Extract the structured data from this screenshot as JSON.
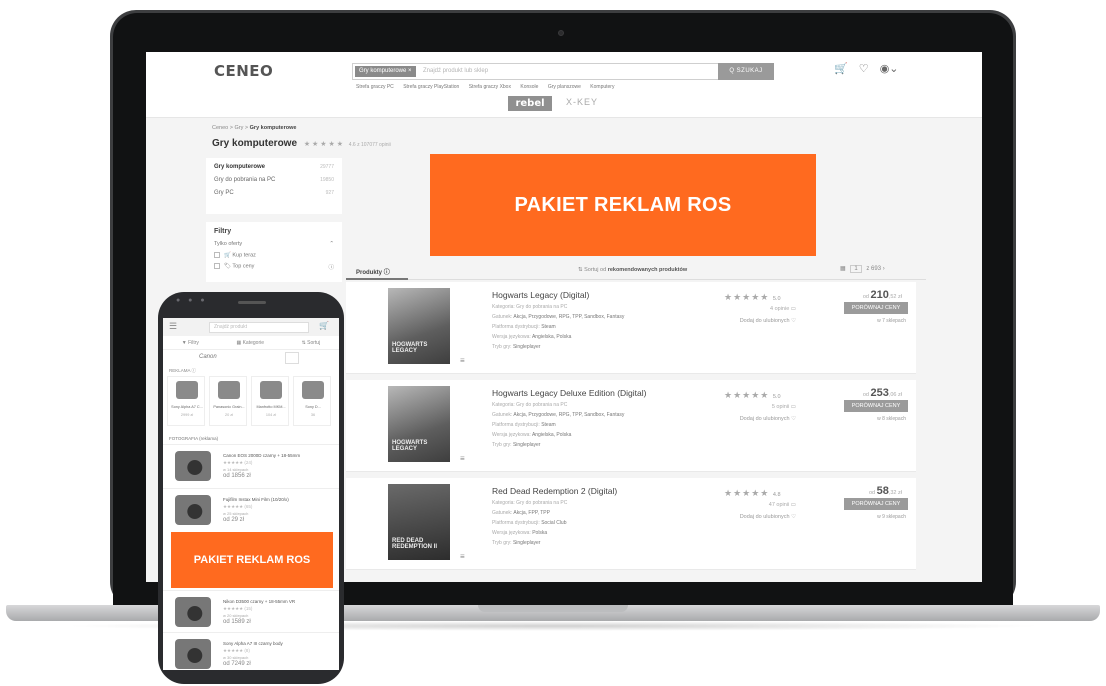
{
  "header": {
    "logo": "CENEO",
    "search_category": "Gry komputerowe ×",
    "search_placeholder": "Znajdź produkt lub sklep",
    "search_button": "Q SZUKAJ",
    "quick_links": [
      "Strefa graczy PC",
      "Strefa graczy PlayStation",
      "Strefa graczy Xbox",
      "Konsole",
      "Gry planszowe",
      "Komputery"
    ],
    "partner_rebel": "rebel",
    "partner_xkey": "X-KEY"
  },
  "breadcrumb": {
    "home": "Ceneo",
    "sep1": ">",
    "level1": "Gry",
    "sep2": ">",
    "current": "Gry komputerowe"
  },
  "page": {
    "title": "Gry komputerowe",
    "stars": "★ ★ ★ ★ ★",
    "rating_meta": "4.6 z 107077 opinii"
  },
  "categories": [
    {
      "label": "Gry komputerowe",
      "count": "29777"
    },
    {
      "label": "Gry do pobrania na PC",
      "count": "19850"
    },
    {
      "label": "Gry PC",
      "count": "927"
    }
  ],
  "filters": {
    "title": "Filtry",
    "only_offers": "Tylko oferty",
    "options": [
      "Kup teraz",
      "Top ceny"
    ]
  },
  "banner_laptop": "PAKIET REKLAM ROS",
  "list_header": {
    "tab_products": "Produkty",
    "sort_prefix": "Sortuj od",
    "sort_value": "rekomendowanych produktów",
    "page_current": "1",
    "page_total": "z 693"
  },
  "products": [
    {
      "name": "Hogwarts Legacy (Digital)",
      "category": "Kategoria: Gry do pobrania na PC",
      "genre_label": "Gatunek:",
      "genre": "Akcja, Przygodowe, RPG, TPP, Sandbox, Fantasy",
      "platform_label": "Platforma dystrybucji:",
      "platform": "Steam",
      "lang_label": "Wersja językowa:",
      "lang": "Angielska, Polska",
      "mode_label": "Tryb gry:",
      "mode": "Singleplayer",
      "stars": "★★★★★",
      "score": "5.0",
      "opinions": "4 opinie",
      "fav": "Dodaj do ulubionych",
      "price_prefix": "od",
      "price": "210",
      "price_cents": ",52 zł",
      "compare": "PORÓWNAJ CENY",
      "shops": "w 7 sklepach",
      "cover_text": "HOGWARTS LEGACY"
    },
    {
      "name": "Hogwarts Legacy Deluxe Edition (Digital)",
      "category": "Kategoria: Gry do pobrania na PC",
      "genre_label": "Gatunek:",
      "genre": "Akcja, Przygodowe, RPG, TPP, Sandbox, Fantasy",
      "platform_label": "Platforma dystrybucji:",
      "platform": "Steam",
      "lang_label": "Wersja językowa:",
      "lang": "Angielska, Polska",
      "mode_label": "Tryb gry:",
      "mode": "Singleplayer",
      "stars": "★★★★★",
      "score": "5.0",
      "opinions": "5 opinii",
      "fav": "Dodaj do ulubionych",
      "price_prefix": "od",
      "price": "253",
      "price_cents": ",06 zł",
      "compare": "PORÓWNAJ CENY",
      "shops": "w 8 sklepach",
      "cover_text": "HOGWARTS LEGACY"
    },
    {
      "name": "Red Dead Redemption 2 (Digital)",
      "category": "Kategoria: Gry do pobrania na PC",
      "genre_label": "Gatunek:",
      "genre": "Akcja, FPP, TPP",
      "platform_label": "Platforma dystrybucji:",
      "platform": "Social Club",
      "lang_label": "Wersja językowa:",
      "lang": "Polska",
      "mode_label": "Tryb gry:",
      "mode": "Singleplayer",
      "stars": "★★★★★",
      "score": "4.8",
      "opinions": "47 opinii",
      "fav": "Dodaj do ulubionych",
      "price_prefix": "od",
      "price": "58",
      "price_cents": ",32 zł",
      "compare": "PORÓWNAJ CENY",
      "shops": "w 9 sklepach",
      "cover_text": "RED DEAD REDEMPTION II"
    }
  ],
  "phone": {
    "search_placeholder": "Znajdź produkt",
    "tools": [
      "▼ Filtry",
      "▦ Kategorie",
      "⇅ Sortuj"
    ],
    "brand": "Canon",
    "ad_label": "REKLAMA ⓘ",
    "carousel": [
      {
        "title": "Sony Alpha A7 C...",
        "price": "2999 zł"
      },
      {
        "title": "Panasonic Grain...",
        "price": "20 zł"
      },
      {
        "title": "Manfrotto MKM...",
        "price": "104 zł"
      },
      {
        "title": "Sony D...",
        "price": "36"
      }
    ],
    "section": "FOTOGRAFIA (reklama)",
    "items": [
      {
        "name": "Canon EOS 2000D czarny + 18-55mm",
        "stars": "★★★★★ (24)",
        "shops": "w 14 sklepach",
        "price": "od 1856 zł"
      },
      {
        "name": "Fujifilm Instax Mini Film (10/20/x)",
        "stars": "★★★★★ (65)",
        "shops": "w 25 sklepach",
        "price": "od 29 zł"
      },
      {
        "name": "Nikon D3500 czarny + 18-55mm VR",
        "stars": "★★★★★ (15)",
        "shops": "w 20 sklepach",
        "price": "od 1589 zł"
      },
      {
        "name": "Sony Alpha A7 III czarny body",
        "stars": "★★★★★ (8)",
        "shops": "w 30 sklepach",
        "price": "od 7249 zł"
      }
    ],
    "banner": "PAKIET REKLAM ROS"
  }
}
